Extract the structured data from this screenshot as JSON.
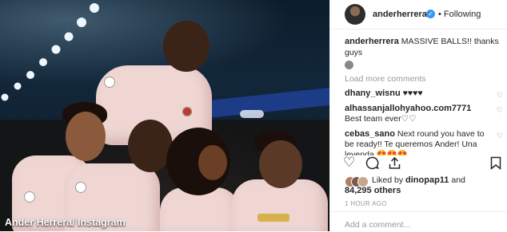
{
  "post": {
    "author": "anderherrera",
    "follow_status": "Following",
    "verified_icon": "verified-badge-icon",
    "caption_username": "anderherrera",
    "caption_text": "MASSIVE BALLS!! thanks guys",
    "load_more": "Load more comments",
    "comments": [
      {
        "username": "dhany_wisnu",
        "text": "♥♥♥♥"
      },
      {
        "username": "alhassanjallohyahoo.com7771",
        "text": "Best team ever♡♡"
      },
      {
        "username": "cebas_sano",
        "text": "Next round you have to be ready!! Te queremos Ander! Una leyenda 😍😍😍"
      }
    ],
    "liked_by_prefix": "Liked by",
    "liked_by_user": "dinopap11",
    "liked_by_and": "and",
    "liked_by_others": "84,295 others",
    "time_ago": "1 HOUR AGO",
    "add_comment_placeholder": "Add a comment..."
  },
  "photo": {
    "credit": "Ander Herrera/ Instagram",
    "accent_colors": {
      "kit": "#efd6d3",
      "stand_banner": "#1c3c88"
    }
  },
  "icons": {
    "like": "heart-icon",
    "comment": "comment-icon",
    "share": "share-icon",
    "save": "bookmark-icon"
  },
  "colors": {
    "verified": "#3897f0",
    "text": "#262626",
    "muted": "#999999"
  }
}
